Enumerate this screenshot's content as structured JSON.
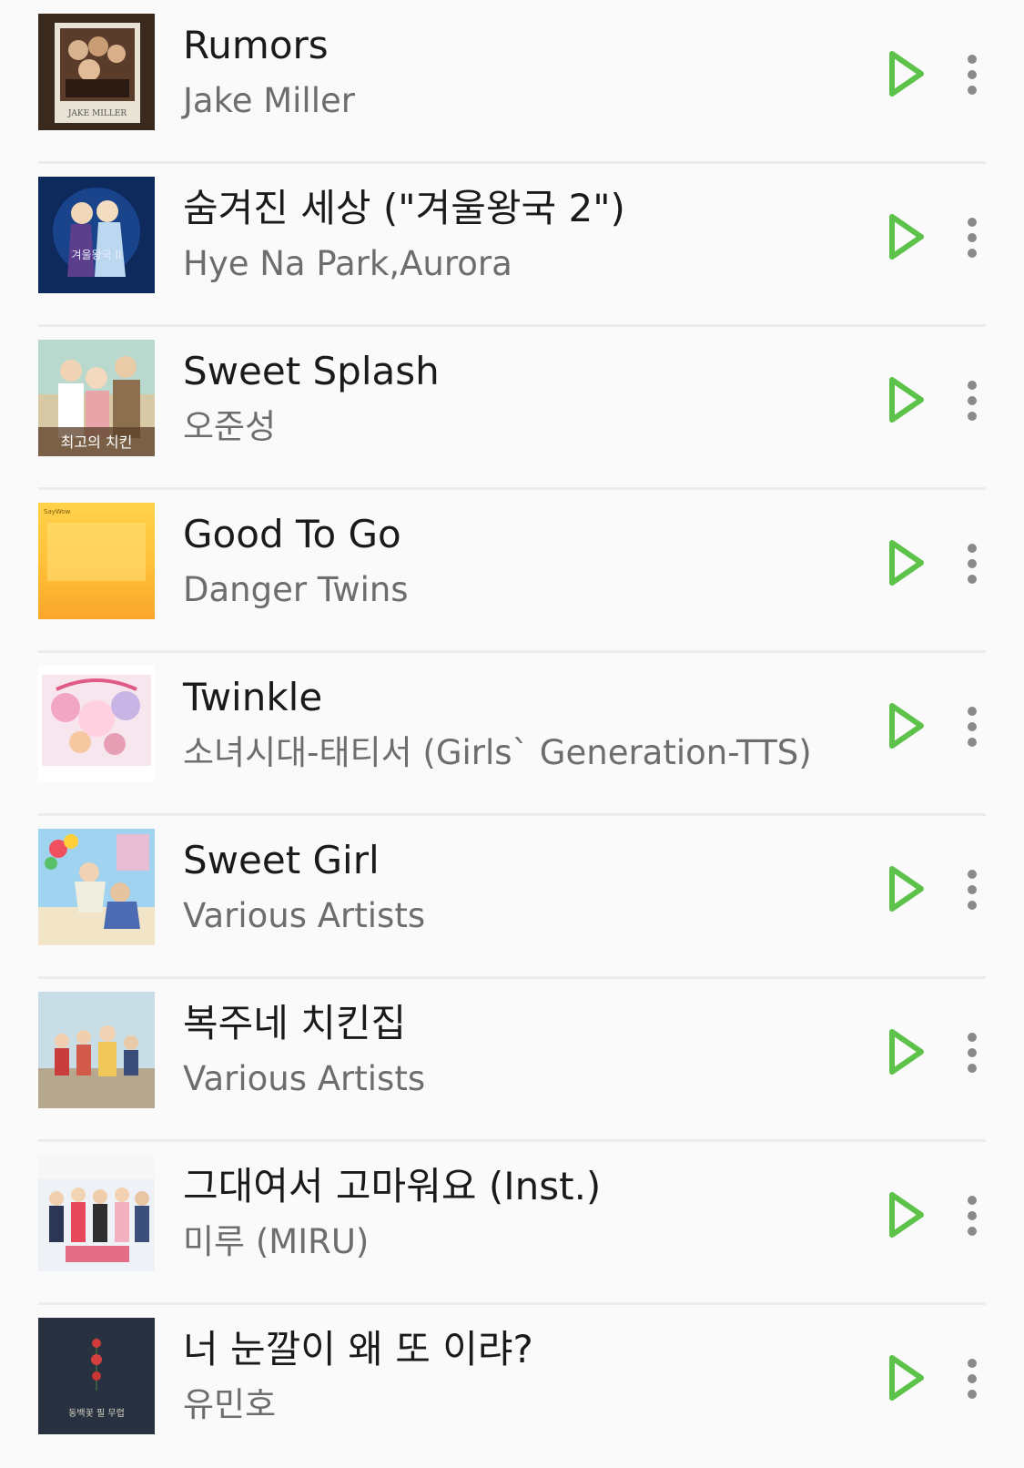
{
  "colors": {
    "background": "#fafafa",
    "accent_play": "#5cc24a",
    "title_text": "#1a1a1a",
    "artist_text": "#6d6d6d",
    "divider": "#ececec",
    "more_dots": "#8a8a8a"
  },
  "songs": [
    {
      "title": "Rumors",
      "artist": "Jake Miller",
      "art_icon": "album-art-rumors",
      "art_text": "JAKE MILLER"
    },
    {
      "title": "숨겨진 세상 (\"겨울왕국 2\")",
      "artist": "Hye Na Park,Aurora",
      "art_icon": "album-art-frozen-2",
      "art_text": "겨울왕국 II"
    },
    {
      "title": "Sweet Splash",
      "artist": "오준성",
      "art_icon": "album-art-sweet-splash",
      "art_text": "최고의 치킨"
    },
    {
      "title": "Good To Go",
      "artist": "Danger Twins",
      "art_icon": "album-art-good-to-go",
      "art_text": "SayWow"
    },
    {
      "title": "Twinkle",
      "artist": "소녀시대-태티서 (Girls` Generation-TTS)",
      "art_icon": "album-art-twinkle",
      "art_text": ""
    },
    {
      "title": "Sweet Girl",
      "artist": "Various Artists",
      "art_icon": "album-art-sweet-girl",
      "art_text": ""
    },
    {
      "title": "복주네 치킨집",
      "artist": "Various Artists",
      "art_icon": "album-art-bokju-chicken",
      "art_text": ""
    },
    {
      "title": "그대여서 고마워요 (Inst.)",
      "artist": "미루 (MIRU)",
      "art_icon": "album-art-thank-you",
      "art_text": ""
    },
    {
      "title": "너 눈깔이 왜 또 이랴?",
      "artist": "유민호",
      "art_icon": "album-art-dark-flowers",
      "art_text": "동백꽃 필 무렵"
    }
  ],
  "actions": {
    "play_icon": "play-icon",
    "more_icon": "more-vertical-icon"
  }
}
